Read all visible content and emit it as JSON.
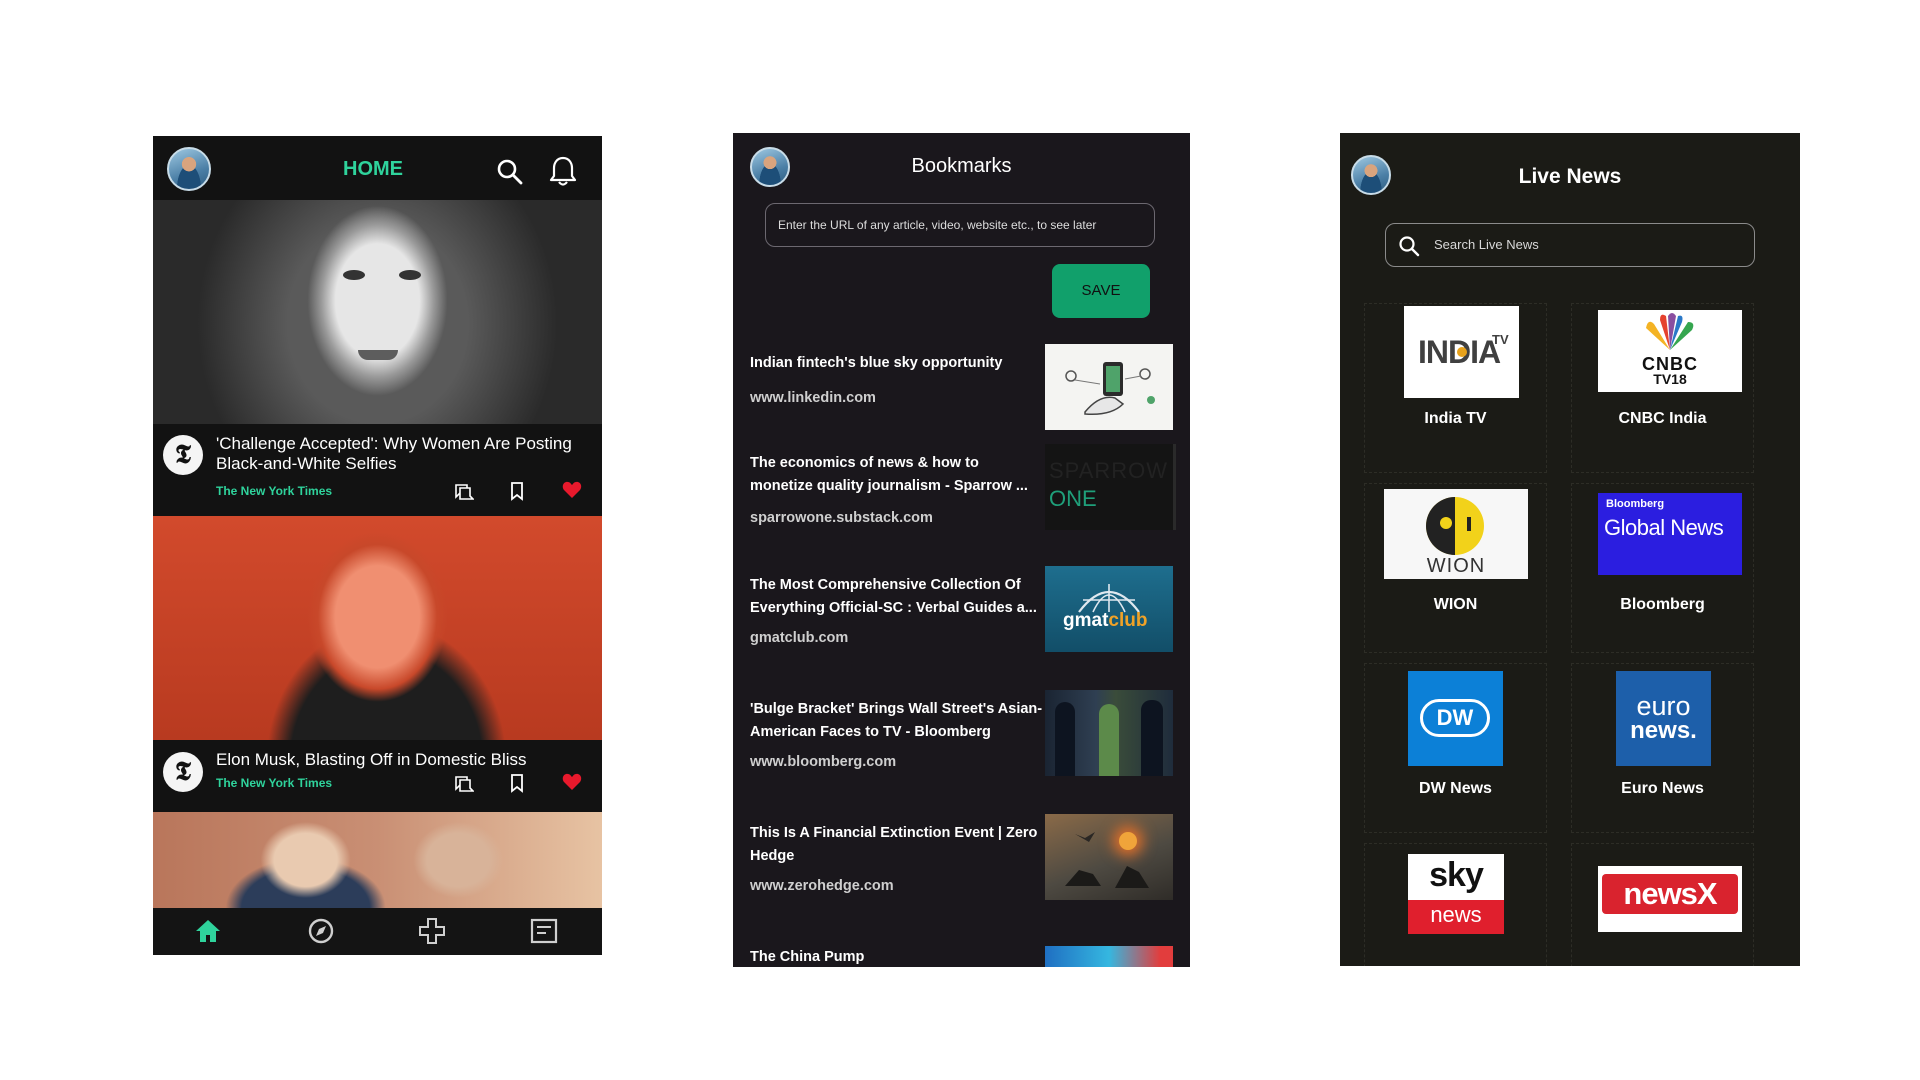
{
  "home": {
    "title": "HOME",
    "articles": [
      {
        "title": "'Challenge Accepted': Why Women Are Posting Black-and-White Selfies",
        "source": "The New York Times"
      },
      {
        "title": "Elon Musk, Blasting Off in Domestic Bliss",
        "source": "The New York Times"
      }
    ],
    "nav_icons": [
      "home-icon",
      "compass-icon",
      "plus-icon",
      "feed-icon"
    ]
  },
  "bookmarks": {
    "title": "Bookmarks",
    "url_placeholder": "Enter the URL of any article, video, website etc., to see later",
    "save_label": "SAVE",
    "items": [
      {
        "title": "Indian fintech's blue sky opportunity",
        "url": "www.linkedin.com"
      },
      {
        "title": "The economics of news & how to monetize quality journalism - Sparrow ...",
        "url": "sparrowone.substack.com",
        "thumb_text_1": "SPARROW",
        "thumb_text_2": "ONE"
      },
      {
        "title": "The Most Comprehensive Collection Of Everything Official-SC : Verbal Guides a...",
        "url": "gmatclub.com",
        "thumb_text_1": "gmat",
        "thumb_text_2": "club"
      },
      {
        "title": "'Bulge Bracket' Brings Wall Street's Asian-American Faces to TV - Bloomberg",
        "url": "www.bloomberg.com"
      },
      {
        "title": "This Is A Financial Extinction Event | Zero Hedge",
        "url": "www.zerohedge.com"
      },
      {
        "title": "The China Pump",
        "url": ""
      }
    ]
  },
  "live": {
    "title": "Live News",
    "search_placeholder": "Search Live News",
    "channels": [
      {
        "name": "India TV",
        "logo_text": "INDIA",
        "logo_sup": "TV"
      },
      {
        "name": "CNBC India",
        "logo_text": "CNBC",
        "logo_sub": "TV18"
      },
      {
        "name": "WION",
        "logo_text": "WION"
      },
      {
        "name": "Bloomberg",
        "logo_text": "Global News",
        "logo_small": "Bloomberg"
      },
      {
        "name": "DW News",
        "logo_text": "DW"
      },
      {
        "name": "Euro News",
        "logo_text": "euro",
        "logo_text2": "news."
      },
      {
        "name": "",
        "logo_text": "sky",
        "logo_text2": "news"
      },
      {
        "name": "",
        "logo_text": "newsX"
      }
    ],
    "colors": {
      "india_tv_accent": "#e8a21b",
      "bloomberg_bg": "#2b1ee0",
      "dw_bg": "#0c80d7",
      "euronews_bg": "#1d5faa",
      "sky_red": "#e01f2d",
      "newsx_red": "#d9232e"
    }
  },
  "accent": "#2fd39c"
}
